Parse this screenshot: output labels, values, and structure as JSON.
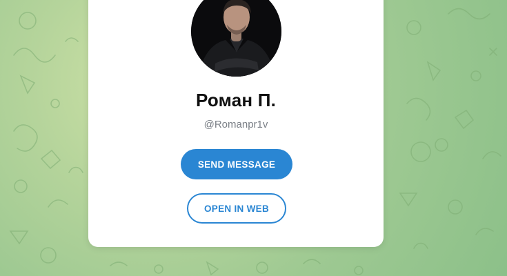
{
  "profile": {
    "name": "Роман П.",
    "username": "@Romanpr1v",
    "avatar_icon": "profile-photo"
  },
  "buttons": {
    "send_message": "SEND MESSAGE",
    "open_in_web": "OPEN IN WEB"
  },
  "colors": {
    "accent": "#2a86d3",
    "background": "#a3cb92",
    "card": "#ffffff"
  }
}
